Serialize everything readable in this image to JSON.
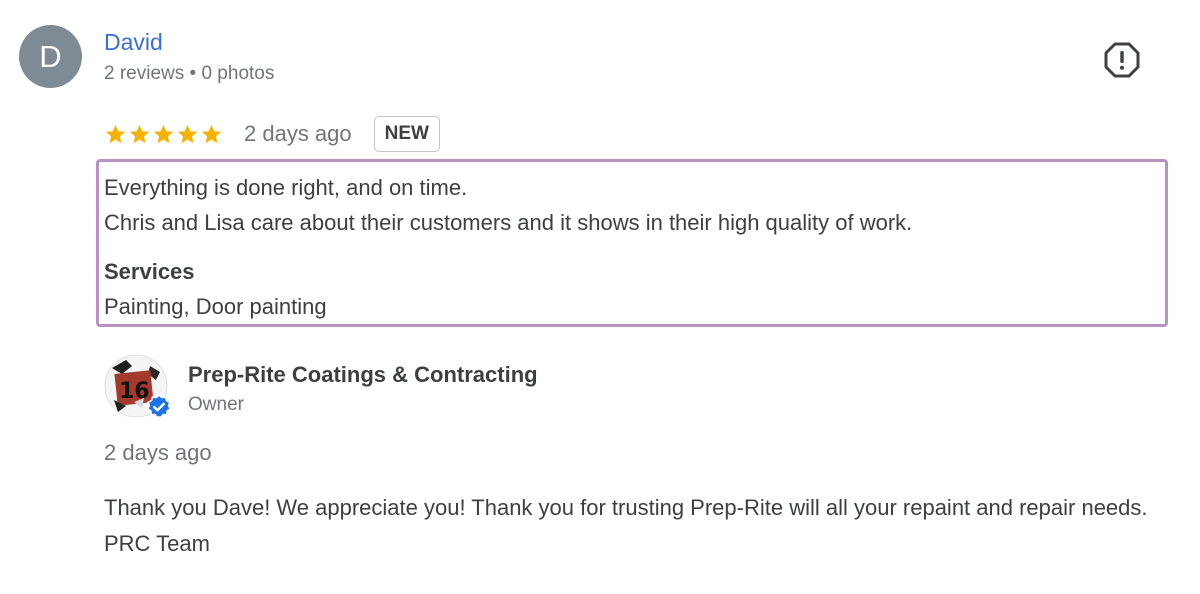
{
  "review": {
    "avatar_letter": "D",
    "reviewer_name": "David",
    "reviewer_meta": "2 reviews • 0 photos",
    "rating": 5,
    "rating_max": 5,
    "date": "2 days ago",
    "badge": "NEW",
    "text_line1": "Everything is done right, and on time.",
    "text_line2": "Chris and Lisa care about their customers and it shows in their high quality of work.",
    "services_label": "Services",
    "services_value": "Painting, Door painting",
    "report_icon": "report-icon"
  },
  "owner_reply": {
    "logo_icon": "business-logo",
    "verified_icon": "verified-badge-icon",
    "business_name": "Prep-Rite Coatings & Contracting",
    "role": "Owner",
    "date": "2 days ago",
    "text": "Thank you Dave! We appreciate you! Thank you for trusting Prep-Rite will all your repaint and repair needs. PRC Team"
  },
  "colors": {
    "star": "#f4b400",
    "name_link": "#3c6fd1",
    "highlight_border": "#b892c3",
    "verified": "#1a73e8"
  }
}
